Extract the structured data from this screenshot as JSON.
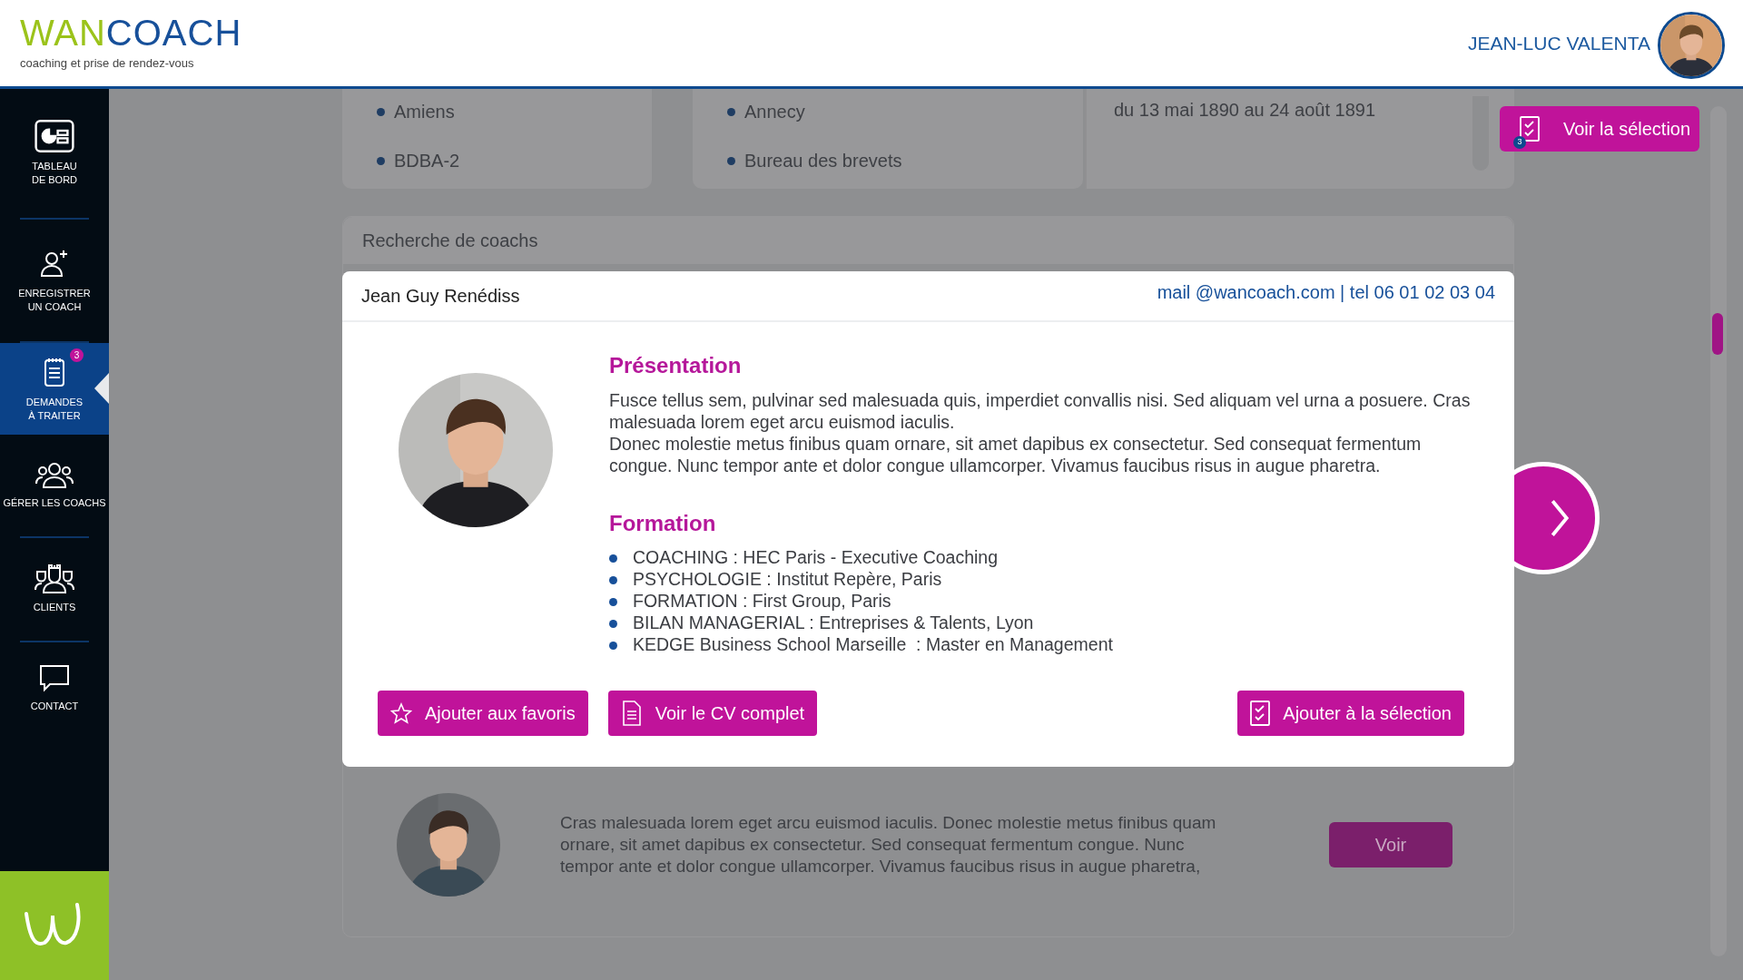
{
  "header": {
    "logo": {
      "part1": "WAN",
      "part2": "COACH",
      "tagline": "coaching et prise de rendez-vous"
    },
    "user": {
      "name": "JEAN-LUC VALENTA"
    }
  },
  "sidebar": {
    "items": [
      {
        "label": "TABLEAU\nDE BORD",
        "selected": false
      },
      {
        "label": "ENREGISTRER\nUN COACH",
        "selected": false
      },
      {
        "label": "DEMANDES\nÀ TRAITER",
        "selected": true,
        "badge": "3"
      },
      {
        "label": "GÉRER LES COACHS",
        "selected": false
      },
      {
        "label": "CLIENTS",
        "selected": false
      },
      {
        "label": "CONTACT",
        "selected": false
      }
    ]
  },
  "top_cards": [
    {
      "items": [
        "Amiens",
        "BDBA-2"
      ]
    },
    {
      "items": [
        "Annecy",
        "Bureau des brevets"
      ]
    },
    {
      "lines": [
        "du 13 mai 1890 au 24 août 1891"
      ]
    }
  ],
  "selection_button": {
    "label": "Voir la sélection",
    "count": "3"
  },
  "search_panel": {
    "title": "Recherche de coachs",
    "result": {
      "text": "Cras malesuada lorem eget arcu euismod iaculis. Donec molestie metus finibus quam ornare, sit amet dapibus ex consectetur. Sed consequat fermentum congue. Nunc tempor ante et dolor congue ullamcorper. Vivamus faucibus risus in augue pharetra,",
      "button": "Voir"
    }
  },
  "modal": {
    "name": "Jean Guy Renédiss",
    "contact": "mail @wancoach.com | tel  06 01 02 03 04",
    "presentation": {
      "title": "Présentation",
      "paragraphs": [
        "Fusce tellus sem, pulvinar sed malesuada quis, imperdiet convallis nisi. Sed aliquam vel urna a posuere. Cras malesuada lorem eget arcu euismod iaculis.",
        "Donec molestie metus finibus quam ornare, sit amet dapibus ex consectetur. Sed consequat fermentum congue. Nunc tempor ante et dolor congue ullamcorper. Vivamus faucibus risus in augue pharetra."
      ]
    },
    "formation": {
      "title": "Formation",
      "items": [
        "COACHING : HEC Paris - Executive Coaching",
        "PSYCHOLOGIE : Institut Repère, Paris",
        "FORMATION : First Group, Paris",
        "BILAN MANAGERIAL : Entreprises & Talents, Lyon",
        "KEDGE Business School Marseille  : Master en Management"
      ]
    },
    "buttons": [
      {
        "label": "Ajouter aux favoris"
      },
      {
        "label": "Voir le CV complet"
      },
      {
        "label": "Ajouter à la sélection"
      }
    ]
  }
}
